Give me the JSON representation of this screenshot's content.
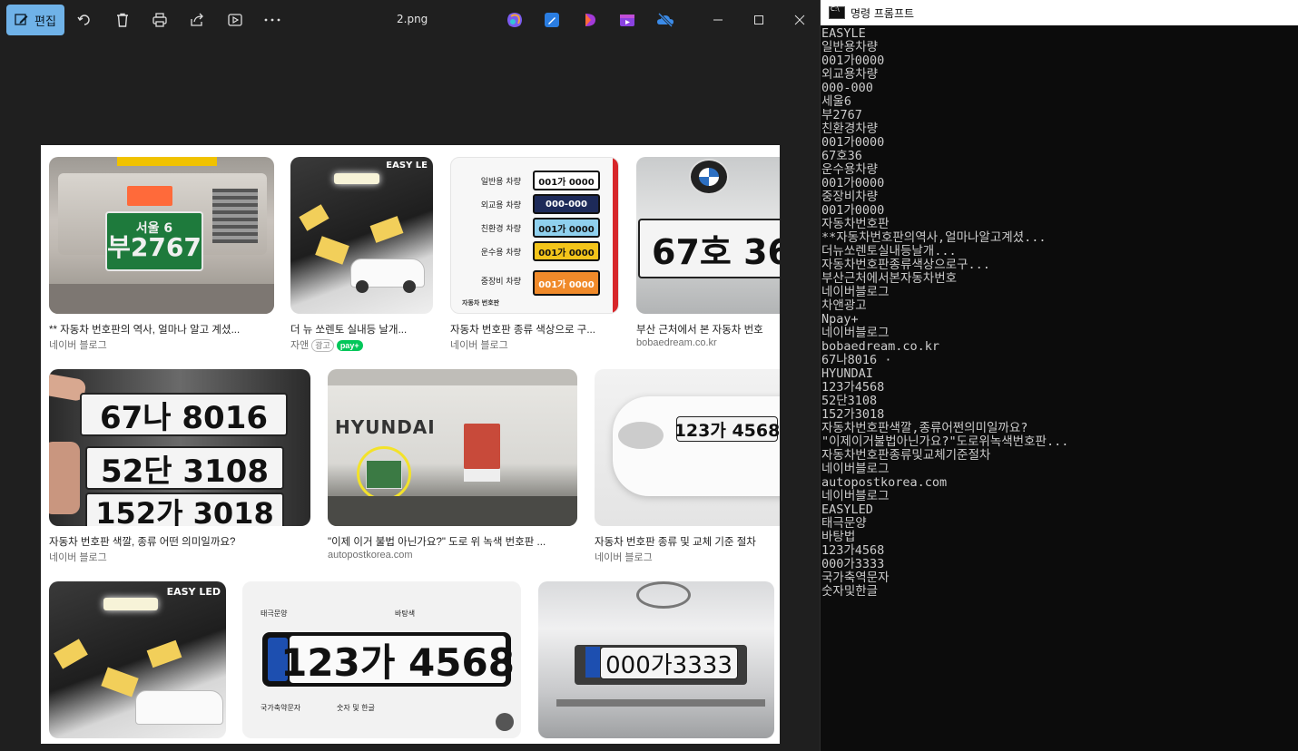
{
  "photos": {
    "edit_label": "편집",
    "file_title": "2.png",
    "tiles": [
      {
        "caption": "** 자동차 번호판의 역사, 얼마나 알고 계셨...",
        "source": "네이버 블로그",
        "plate_line1": "서울 6",
        "plate_line2": "부2767"
      },
      {
        "caption": "더 뉴 쏘렌토 실내등 날개...",
        "source": "자앤",
        "ad": "광고",
        "npay": "pay+",
        "brand": "EASY LE"
      },
      {
        "caption": "자동차 번호판 종류 색상으로 구...",
        "source": "네이버 블로그",
        "rows": [
          {
            "label": "일반용 차량",
            "plate": "001가 0000",
            "color": "#ffffff",
            "text_color": "#111111"
          },
          {
            "label": "외교용 차량",
            "plate": "000-000",
            "color": "#1d2a59",
            "text_color": "#ffffff"
          },
          {
            "label": "친환경 차량",
            "plate": "001가 0000",
            "color": "#8fd0ee",
            "text_color": "#111111"
          },
          {
            "label": "운수용 차량",
            "plate": "001가 0000",
            "color": "#f3c41a",
            "text_color": "#111111"
          },
          {
            "label": "중장비 차량",
            "plate": "001가 0000",
            "color": "#f08a2a",
            "text_color": "#ffffff"
          }
        ],
        "footer": "자동차 번호판"
      },
      {
        "caption": "부산 근처에서 본 자동차 번호",
        "source": "bobaedream.co.kr",
        "plate": "67호 36"
      },
      {
        "caption": "자동차 번호판 색깔, 종류 어떤 의미일까요?",
        "source": "네이버 블로그",
        "plates": [
          "67나 8016",
          "52단 3108",
          "152가 3018"
        ]
      },
      {
        "caption": "\"이제 이거 불법 아닌가요?\" 도로 위 녹색 번호판 ...",
        "source": "autopostkorea.com",
        "brand": "HYUNDAI"
      },
      {
        "caption": "자동차 번호판 종류 및 교체 기준 절차",
        "source": "네이버 블로그",
        "plate": "123가 4568"
      },
      {
        "brand": "EASY LED"
      },
      {
        "plate": "123가 4568",
        "label_tl": "태극문양",
        "label_tr": "바탕색",
        "label_bl": "국가축약문자",
        "label_br": "숫자 및 한글"
      },
      {
        "plate": "000가3333"
      }
    ]
  },
  "cmd": {
    "title": "명령 프롬프트",
    "lines": [
      "EASYLE",
      "일반용차량",
      "001가0000",
      "외교용차량",
      "000-000",
      "세울6",
      "부2767",
      "친환경차량",
      "001가0000",
      "67호36",
      "운수용차량",
      "001가0000",
      "중장비차량",
      "001가0000",
      "자동차번호판",
      "**자동차번호판의역사,얼마나알고계셨...",
      "더뉴쏘렌토실내등날개...",
      "자동차번호판종류색상으로구...",
      "부산근처에서본자동차번호",
      "네이버블로그",
      "차앤광고",
      "Npay+",
      "네이버블로그",
      "bobaedream.co.kr",
      "67나8016 ·",
      "HYUNDAI",
      "123가4568",
      "52단3108",
      "152가3018",
      "자동차번호판색깔,종류어쩐의미일까요?",
      "\"이제이거불법아닌가요?\"도로위녹색번호판...",
      "자동차번호판종류및교체기준절차",
      "네이버블로그",
      "autopostkorea.com",
      "네이버블로그",
      "EASYLED",
      "태극문양",
      "바탕법",
      "123가4568",
      "000가3333",
      "국가축역문자",
      "숫자및한글"
    ]
  }
}
